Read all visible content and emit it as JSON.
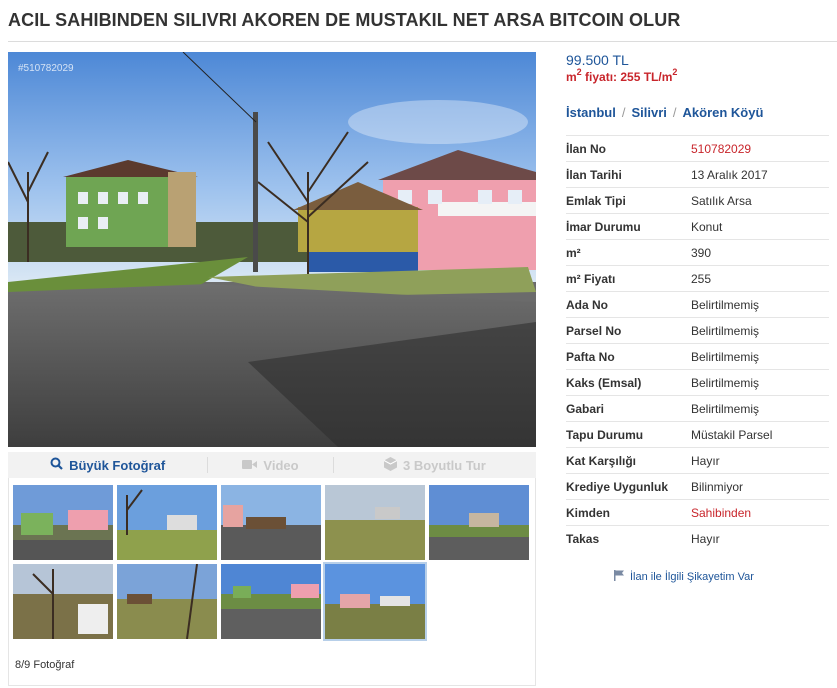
{
  "listing": {
    "title": "ACIL SAHIBINDEN SILIVRI AKOREN DE MUSTAKIL NET ARSA BITCOIN OLUR",
    "photo_id": "#510782029"
  },
  "photo_toolbar": {
    "big_photo": "Büyük Fotoğraf",
    "video": "Video",
    "tour": "3 Boyutlu Tur"
  },
  "gallery": {
    "count_label": "8/9 Fotoğraf",
    "thumbnails": [
      "thumb-1",
      "thumb-2",
      "thumb-3",
      "thumb-4",
      "thumb-5",
      "thumb-6",
      "thumb-7",
      "thumb-8",
      "thumb-9"
    ],
    "active_index": 8
  },
  "price": {
    "value": "99.500 TL",
    "m2_label": "m",
    "m2_sup": "2",
    "m2_text": " fiyatı: 255 TL/m",
    "m2_unit_sup": "2"
  },
  "breadcrumb": {
    "city": "İstanbul",
    "district": "Silivri",
    "neighborhood": "Akören Köyü",
    "separator": "/"
  },
  "details": [
    {
      "label": "İlan No",
      "value": "510782029",
      "highlight": true
    },
    {
      "label": "İlan Tarihi",
      "value": "13 Aralık 2017"
    },
    {
      "label": "Emlak Tipi",
      "value": "Satılık Arsa"
    },
    {
      "label": "İmar Durumu",
      "value": "Konut"
    },
    {
      "label": "m²",
      "value": "390"
    },
    {
      "label": "m² Fiyatı",
      "value": "255"
    },
    {
      "label": "Ada No",
      "value": "Belirtilmemiş"
    },
    {
      "label": "Parsel No",
      "value": "Belirtilmemiş"
    },
    {
      "label": "Pafta No",
      "value": "Belirtilmemiş"
    },
    {
      "label": "Kaks (Emsal)",
      "value": "Belirtilmemiş"
    },
    {
      "label": "Gabari",
      "value": "Belirtilmemiş"
    },
    {
      "label": "Tapu Durumu",
      "value": "Müstakil Parsel"
    },
    {
      "label": "Kat Karşılığı",
      "value": "Hayır"
    },
    {
      "label": "Krediye Uygunluk",
      "value": "Bilinmiyor"
    },
    {
      "label": "Kimden",
      "value": "Sahibinden",
      "highlight": true
    },
    {
      "label": "Takas",
      "value": "Hayır"
    }
  ],
  "complaint": {
    "label": "İlan ile İlgili Şikayetim Var"
  },
  "colors": {
    "link_blue": "#1e5599",
    "accent_red": "#c8252b",
    "border": "#e5e5e5"
  },
  "icons": {
    "big_photo": "magnifier-icon",
    "video": "video-camera-icon",
    "tour": "cube-3d-icon",
    "complaint": "flag-icon"
  }
}
